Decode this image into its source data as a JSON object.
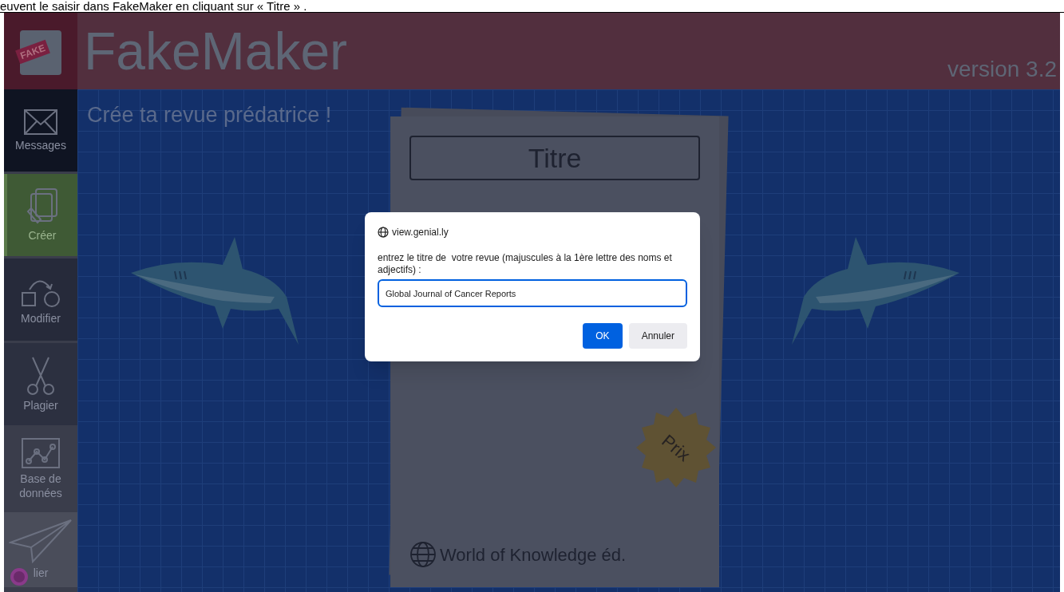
{
  "caption": "euvent le saisir dans FakeMaker en cliquant sur « Titre » .",
  "header": {
    "logo_label": "FAKE",
    "title": "FakeMaker",
    "version": "version 3.2"
  },
  "sidebar": {
    "items": [
      {
        "kind": "mail",
        "label": "Messages",
        "selected": false
      },
      {
        "kind": "pages",
        "label": "Créer",
        "selected": true
      },
      {
        "kind": "shapes",
        "label": "Modifier",
        "selected": false
      },
      {
        "kind": "scissors",
        "label": "Plagier",
        "selected": false
      },
      {
        "kind": "chart",
        "label": "Base de données",
        "selected": false
      },
      {
        "kind": "plane",
        "label": "lier",
        "selected": false
      }
    ]
  },
  "canvas": {
    "subtitle": "Crée ta revue prédatrice !",
    "journal": {
      "title": "Titre",
      "price_badge": "Prix",
      "publisher": "World of Knowledge éd."
    }
  },
  "dialog": {
    "origin": "view.genial.ly",
    "message": "entrez le titre de  votre revue (majuscules à la 1ère lettre des noms et adjectifs) :",
    "value": "Global Journal of Cancer Reports",
    "buttons": [
      "OK",
      "Annuler"
    ]
  }
}
